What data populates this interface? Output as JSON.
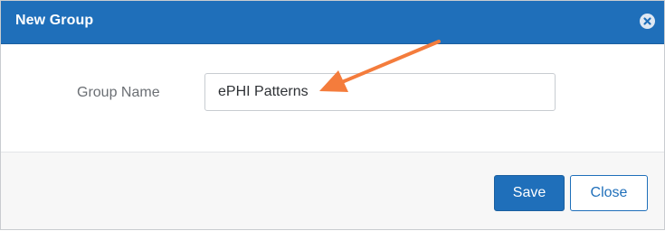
{
  "dialog": {
    "title": "New Group",
    "close_icon": "close-circle-icon"
  },
  "form": {
    "group_name_label": "Group Name",
    "group_name_value": "ePHI Patterns"
  },
  "footer": {
    "save_label": "Save",
    "close_label": "Close"
  },
  "annotation": {
    "arrow_color": "#f47c3c",
    "icon": "arrow-pointer-icon"
  },
  "colors": {
    "accent": "#1f6fba",
    "footer_bg": "#f7f7f7"
  }
}
